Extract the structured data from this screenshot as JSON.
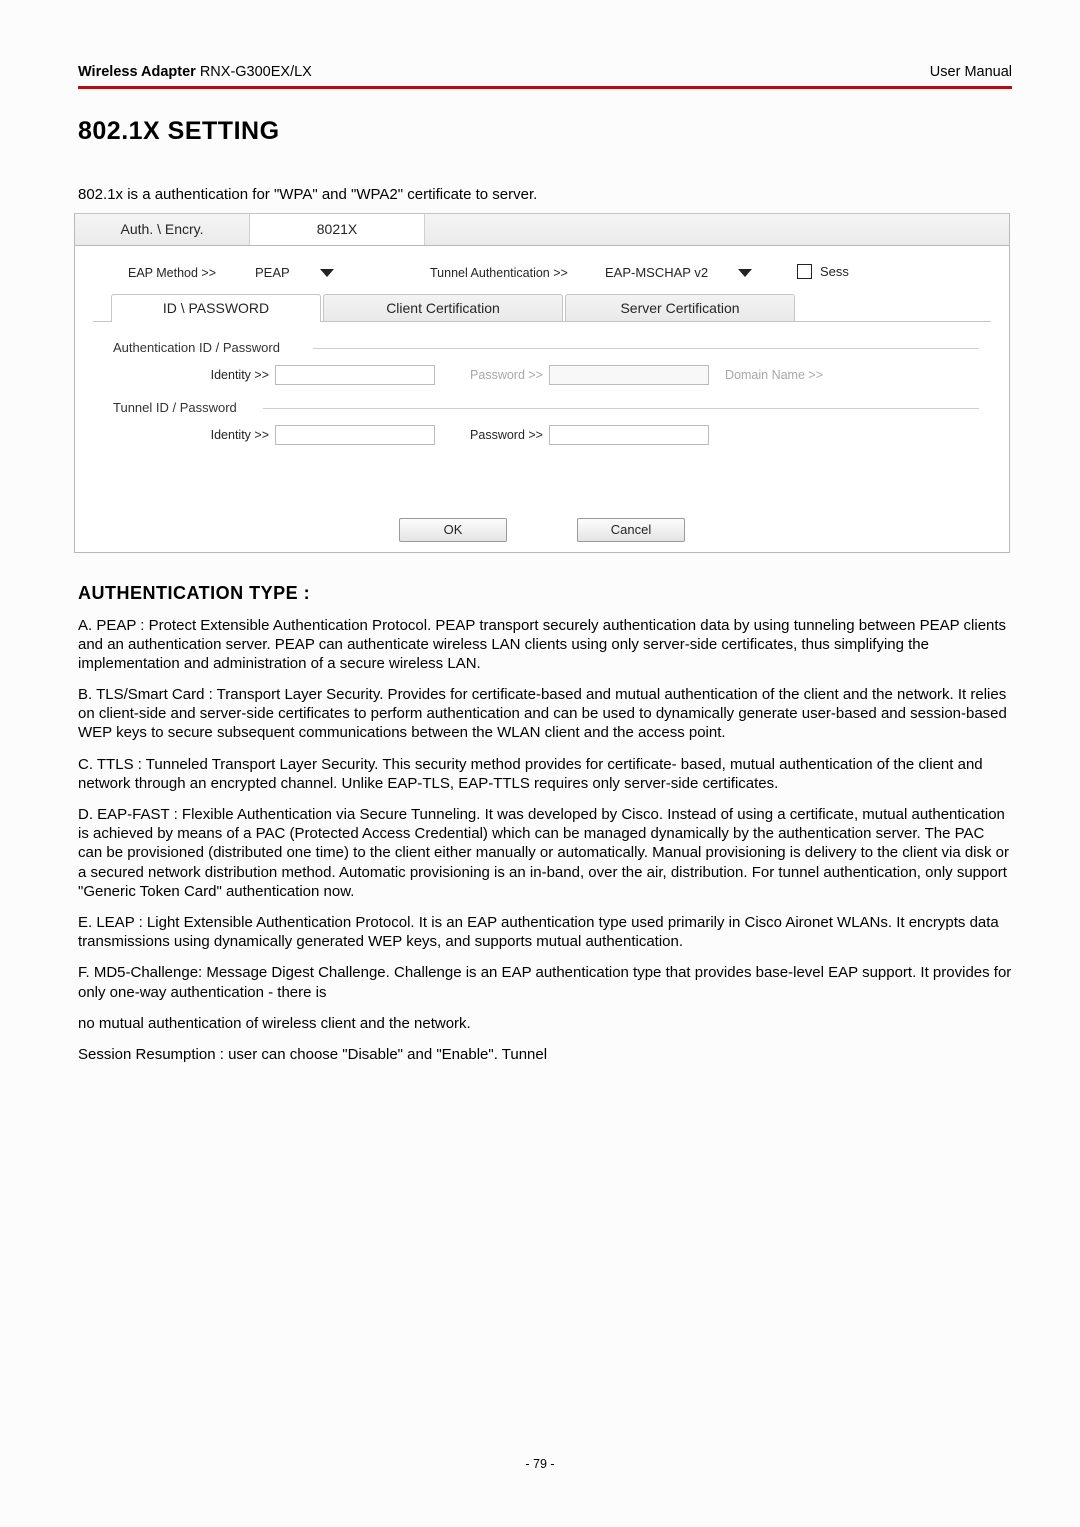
{
  "running_head": {
    "left_bold": "Wireless Adapter",
    "left_rest": " RNX-G300EX/LX",
    "right": "User Manual"
  },
  "section_heading": "802.1X SETTING",
  "intro": "802.1x is a authentication for \"WPA\" and \"WPA2\" certificate to server.",
  "shot": {
    "top_tabs": {
      "t1": "Auth. \\ Encry.",
      "t2": "8021X"
    },
    "eap_label": "EAP Method >>",
    "eap_value": "PEAP",
    "tunnel_label": "Tunnel Authentication >>",
    "tunnel_value": "EAP-MSCHAP v2",
    "session_label": "Sess",
    "sub_tabs": {
      "s1": "ID \\ PASSWORD",
      "s2": "Client Certification",
      "s3": "Server Certification"
    },
    "group1": "Authentication ID / Password",
    "group2": "Tunnel ID / Password",
    "labels": {
      "identity": "Identity >>",
      "password": "Password >>",
      "domain": "Domain Name >>"
    },
    "buttons": {
      "ok": "OK",
      "cancel": "Cancel"
    }
  },
  "auth_heading": "AUTHENTICATION TYPE :",
  "paragraphs": {
    "a": "A. PEAP : Protect Extensible Authentication Protocol. PEAP transport securely authentication data by using tunneling between PEAP clients and an authentication server. PEAP can authenticate wireless LAN clients using only server-side certificates, thus simplifying the implementation and administration of a secure wireless LAN.",
    "b": "B. TLS/Smart Card : Transport Layer Security. Provides for certificate-based and mutual authentication of the client and the network. It relies on client-side and server-side certificates to perform authentication and can be used to dynamically generate user-based and session-based WEP keys to secure subsequent communications between the WLAN client and the access point.",
    "c": "C. TTLS : Tunneled Transport Layer Security. This security method provides for certificate- based, mutual authentication of the client and network through an encrypted channel. Unlike EAP-TLS, EAP-TTLS requires only server-side certificates.",
    "d": "D. EAP-FAST : Flexible Authentication via Secure Tunneling. It was developed by Cisco. Instead of using a certificate, mutual authentication is achieved by means of a PAC (Protected Access Credential) which can be managed dynamically by the authentication server. The PAC can be provisioned (distributed one time) to the client either manually or automatically. Manual provisioning is delivery to the client via disk or a secured network distribution method. Automatic provisioning is an in-band, over the air, distribution. For tunnel authentication, only support \"Generic Token Card\" authentication now.",
    "e": "E. LEAP : Light Extensible Authentication Protocol. It is an EAP authentication type used primarily in Cisco Aironet WLANs. It encrypts data transmissions using dynamically generated WEP keys, and supports mutual authentication.",
    "f": "F. MD5-Challenge: Message Digest Challenge. Challenge is an EAP authentication type that provides base-level EAP support. It provides for only one-way authentication - there is",
    "g": "no mutual authentication of wireless client and the network.",
    "h": "Session Resumption : user can choose \"Disable\" and \"Enable\". Tunnel"
  },
  "page_number": "- 79 -"
}
